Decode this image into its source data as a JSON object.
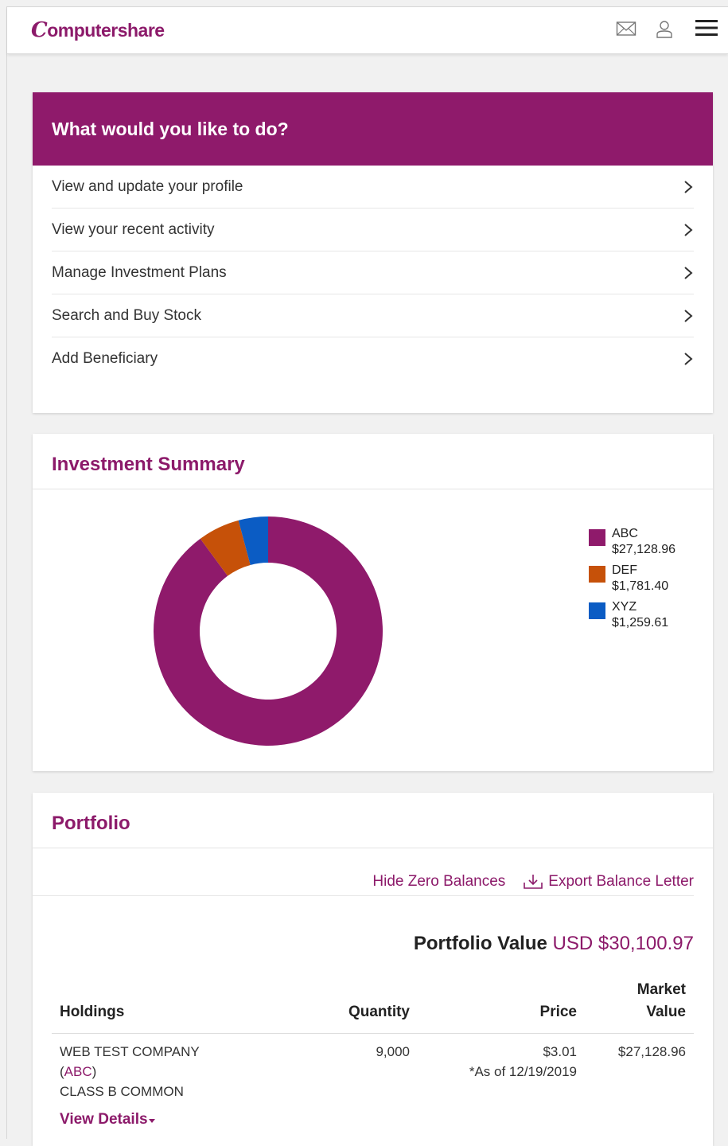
{
  "header": {
    "logo_initial": "C",
    "logo_rest": "omputershare",
    "icons": [
      "mail-icon",
      "user-icon",
      "hamburger-menu-icon"
    ]
  },
  "todo": {
    "title": "What would you like to do?",
    "items": [
      {
        "label": "View and update your profile"
      },
      {
        "label": "View your recent activity"
      },
      {
        "label": "Manage Investment Plans"
      },
      {
        "label": "Search and Buy Stock"
      },
      {
        "label": "Add Beneficiary"
      }
    ]
  },
  "summary": {
    "title": "Investment Summary",
    "legend": [
      {
        "ticker": "ABC",
        "value": "$27,128.96"
      },
      {
        "ticker": "DEF",
        "value": "$1,781.40"
      },
      {
        "ticker": "XYZ",
        "value": "$1,259.61"
      }
    ]
  },
  "chart_data": {
    "type": "pie",
    "categories": [
      "ABC",
      "DEF",
      "XYZ"
    ],
    "values": [
      27128.96,
      1781.4,
      1259.61
    ],
    "colors": [
      "#8f1a6b",
      "#c65109",
      "#0b5cc4"
    ],
    "legend_position": "right"
  },
  "portfolio": {
    "title": "Portfolio",
    "hide_zero": "Hide Zero Balances",
    "export": "Export Balance Letter",
    "value_label": "Portfolio Value",
    "value_amount": "USD $30,100.97",
    "columns": {
      "holdings": "Holdings",
      "quantity": "Quantity",
      "price": "Price",
      "market_1": "Market",
      "market_2": "Value"
    },
    "rows": [
      {
        "company": "WEB TEST COMPANY",
        "ticker_open": "(",
        "ticker": "ABC",
        "ticker_close": ")",
        "class": "CLASS B COMMON",
        "quantity": "9,000",
        "price": "$3.01",
        "as_of": "*As of 12/19/2019",
        "market_value": "$27,128.96",
        "details": "View Details"
      }
    ]
  },
  "colors": {
    "brand": "#8f1a6b",
    "accent_text": "#8c1a6a"
  }
}
